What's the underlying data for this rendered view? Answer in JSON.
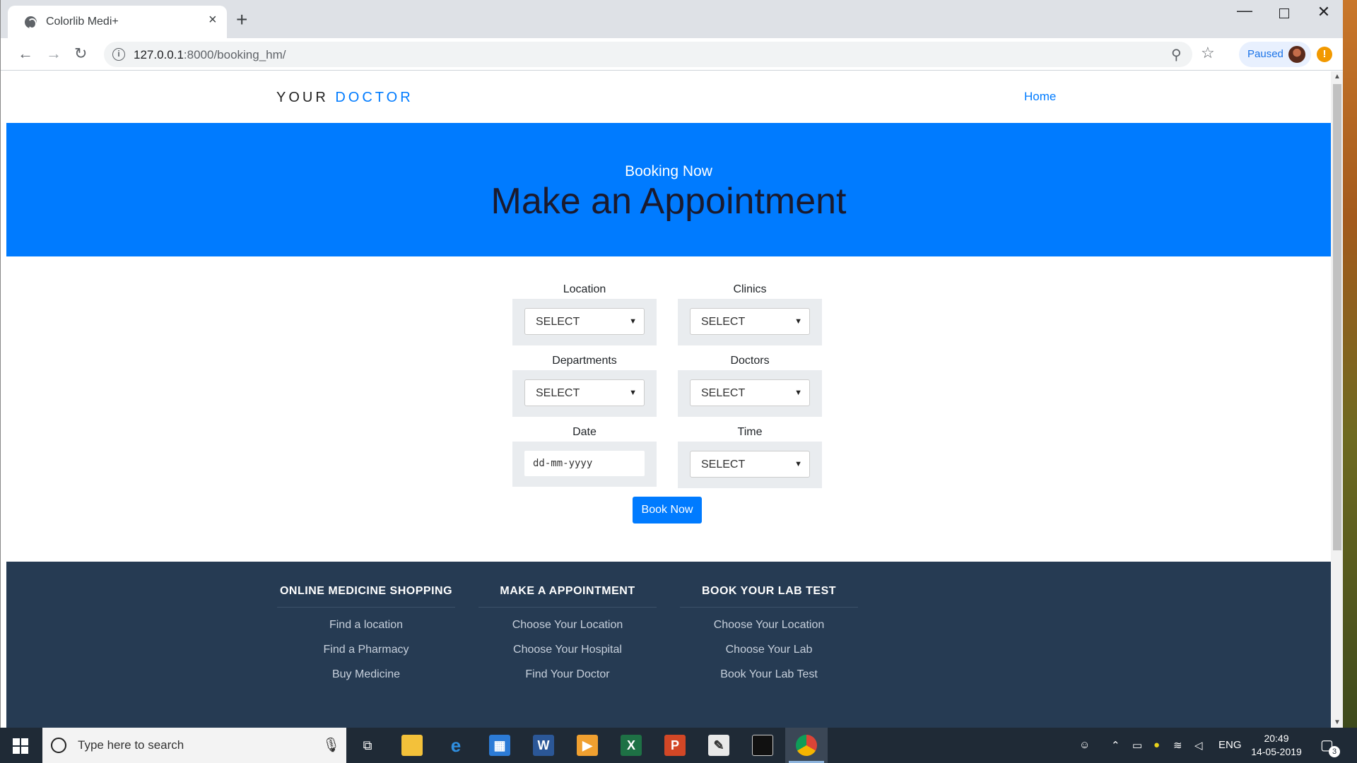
{
  "browser": {
    "tab_title": "Colorlib Medi+",
    "tab_close": "×",
    "new_tab": "+",
    "url_host": "127.0.0.1",
    "url_path": ":8000/booking_hm/",
    "profile_status": "Paused",
    "nav_back": "←",
    "nav_forward": "→",
    "nav_reload": "↻",
    "zoom_glyph": "⚲",
    "star_glyph": "☆",
    "alert_glyph": "!",
    "info_glyph": "i",
    "min_glyph": "—",
    "close_glyph": "✕"
  },
  "site": {
    "logo_prefix": "YOUR",
    "logo_accent": "DOCTOR",
    "nav_home": "Home",
    "accent_color": "#007bff"
  },
  "hero": {
    "subtitle": "Booking Now",
    "title": "Make an Appointment"
  },
  "form": {
    "location": {
      "label": "Location",
      "value": "SELECT"
    },
    "clinics": {
      "label": "Clinics",
      "value": "SELECT"
    },
    "departments": {
      "label": "Departments",
      "value": "SELECT"
    },
    "doctors": {
      "label": "Doctors",
      "value": "SELECT"
    },
    "date": {
      "label": "Date",
      "placeholder": "dd-mm-yyyy"
    },
    "time": {
      "label": "Time",
      "value": "SELECT"
    },
    "submit_label": "Book Now",
    "caret": "▼"
  },
  "footer": {
    "columns": [
      {
        "heading": "ONLINE MEDICINE SHOPPING",
        "links": [
          "Find a location",
          "Find a Pharmacy",
          "Buy Medicine"
        ]
      },
      {
        "heading": "MAKE A APPOINTMENT",
        "links": [
          "Choose Your Location",
          "Choose Your Hospital",
          "Find Your Doctor"
        ]
      },
      {
        "heading": "BOOK YOUR LAB TEST",
        "links": [
          "Choose Your Location",
          "Choose Your Lab",
          "Book Your Lab Test"
        ]
      }
    ]
  },
  "taskbar": {
    "search_placeholder": "Type here to search",
    "language": "ENG",
    "time": "20:49",
    "date": "14-05-2019",
    "notification_count": "3",
    "apps": [
      "task-view",
      "file-explorer",
      "edge",
      "outlook",
      "word",
      "media-player",
      "excel",
      "powerpoint",
      "notepad",
      "terminal",
      "chrome"
    ]
  }
}
